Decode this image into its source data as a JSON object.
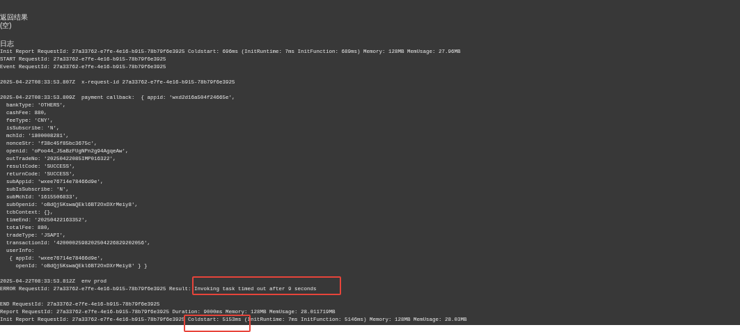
{
  "result": {
    "heading": "返回结果",
    "value": "(空)"
  },
  "log": {
    "heading": "日志",
    "blocks": [
      [
        "Init Report RequestId: 27a33762-e7fe-4e16-b915-78b79f6e3925 Coldstart: 696ms (InitRuntime: 7ms InitFunction: 689ms) Memory: 128MB MemUsage: 27.96MB",
        "START RequestId: 27a33762-e7fe-4e16-b915-78b79f6e3925",
        "Event RequestId: 27a33762-e7fe-4e16-b915-78b79f6e3925"
      ],
      [
        "2025-04-22T08:33:53.807Z  x-request-id 27a33762-e7fe-4e16-b915-78b79f6e3925"
      ],
      [
        "2025-04-22T08:33:53.809Z  payment callback:  { appid: 'wxd2d16a504f24665e',",
        "  bankType: 'OTHERS',",
        "  cashFee: 880,",
        "  feeType: 'CNY',",
        "  isSubscribe: 'N',",
        "  mchId: '1800008281',",
        "  nonceStr: 'f38c45f85bc3675c',",
        "  openid: 'oPoo44_J5aBzFUgNPn2g94AgqeAw',",
        "  outTradeNo: '20250422085IMP016322',",
        "  resultCode: 'SUCCESS',",
        "  returnCode: 'SUCCESS',",
        "  subAppid: 'wxee76714e78466d9e',",
        "  subIsSubscribe: 'N',",
        "  subMchId: '1615506833',",
        "  subOpenid: 'oBdQj5KswaQEkl6BT2OxDXrMeiy8',",
        "  tcbContext: {},",
        "  timeEnd: '20250422163352',",
        "  totalFee: 880,",
        "  tradeType: 'JSAPI',",
        "  transactionId: '4200002598202504226829202056',",
        "  userInfo:",
        "   { appId: 'wxee76714e78466d9e',",
        "     openId: 'oBdQj5KswaQEkl6BT2OxDXrMeiy8' } }"
      ],
      [
        "2025-04-22T08:33:53.812Z  env prod",
        "ERROR RequestId: 27a33762-e7fe-4e16-b915-78b79f6e3925 Result: Invoking task timed out after 9 seconds"
      ],
      [
        "END RequestId: 27a33762-e7fe-4e16-b915-78b79f6e3925",
        "Report RequestId: 27a33762-e7fe-4e16-b915-78b79f6e3925 Duration: 9000ms Memory: 128MB MemUsage: 28.011719MB",
        "Init Report RequestId: 27a33762-e7fe-4e16-b915-78b79f6e3925 Coldstart: 5153ms (InitRuntime: 7ms InitFunction: 5146ms) Memory: 128MB MemUsage: 28.03MB"
      ]
    ]
  }
}
